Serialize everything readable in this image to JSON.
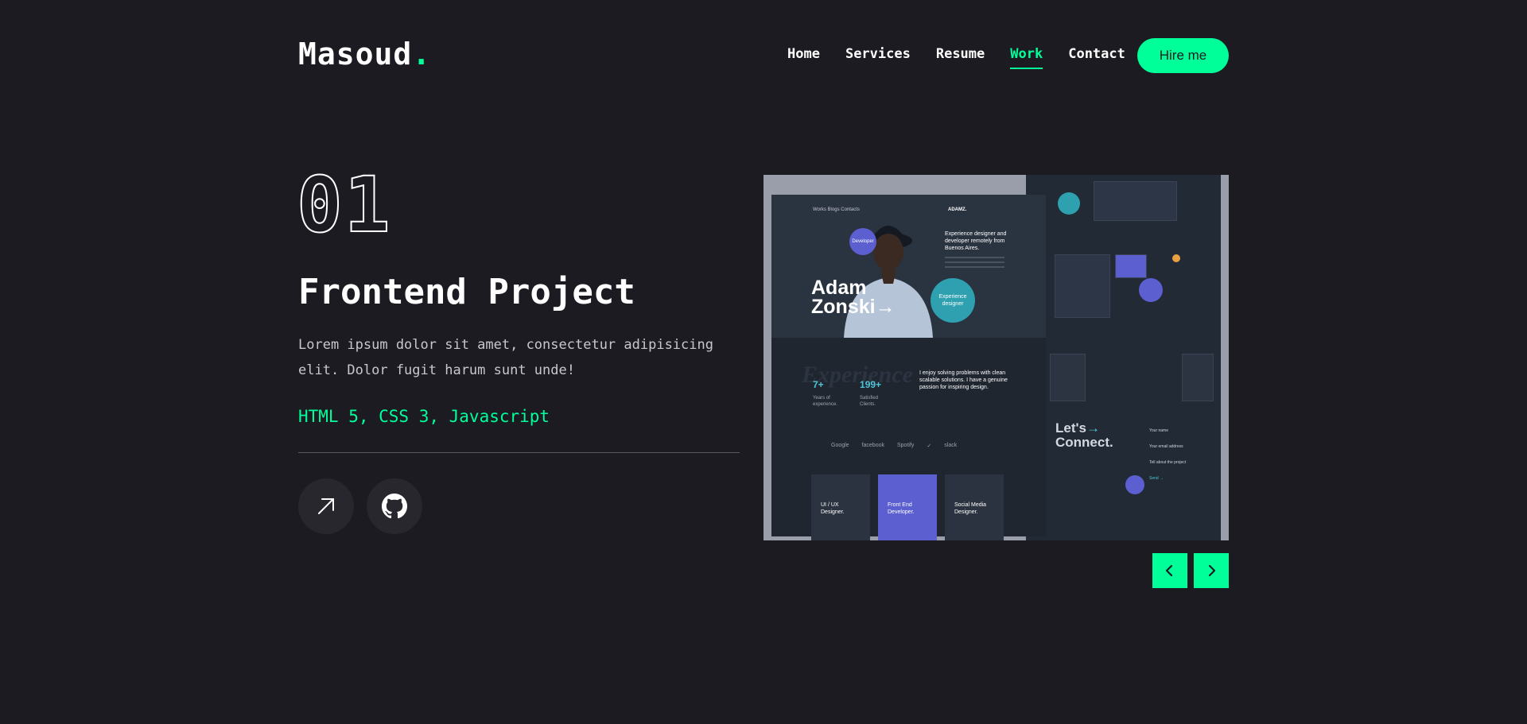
{
  "brand": {
    "name": "Masoud",
    "dot": "."
  },
  "nav": {
    "items": [
      {
        "label": "Home",
        "active": false
      },
      {
        "label": "Services",
        "active": false
      },
      {
        "label": "Resume",
        "active": false
      },
      {
        "label": "Work",
        "active": true
      },
      {
        "label": "Contact",
        "active": false
      }
    ],
    "hire_label": "Hire me"
  },
  "project": {
    "number": "01",
    "title": "Frontend Project",
    "description": "Lorem ipsum dolor sit amet, consectetur adipisicing elit. Dolor fugit harum sunt unde!",
    "stack": "HTML 5, CSS 3, Javascript"
  },
  "actions": {
    "live_icon": "arrow-up-right-icon",
    "github_icon": "github-icon"
  },
  "preview": {
    "nav": "Works   Blogs   Contacts",
    "brand": "ADAMZ.",
    "name_line1": "Adam",
    "name_line2": "Zonski",
    "developer_badge": "Developer",
    "experience_badge_1": "Experience",
    "experience_badge_2": "designer",
    "blurb": "Experience designer and developer remotely from Buenos Aires.",
    "experience_word": "Experience",
    "stats": [
      {
        "value": "7+",
        "label1": "Years of",
        "label2": "experience."
      },
      {
        "value": "199+",
        "label1": "Satisfied",
        "label2": "Clients."
      }
    ],
    "about": "I enjoy solving problems with clean scalable solutions. I have a genuine passion for inspiring design.",
    "logos": [
      "Google",
      "facebook",
      "Spotify",
      "✓",
      "slack"
    ],
    "cards": [
      {
        "line1": "UI / UX",
        "line2": "Designer.",
        "highlight": false
      },
      {
        "line1": "Front End",
        "line2": "Developer.",
        "highlight": true
      },
      {
        "line1": "Social Media",
        "line2": "Designer.",
        "highlight": false
      }
    ],
    "connect_line1": "Let's",
    "connect_line2": "Connect.",
    "form": [
      "Your name",
      "Your email address",
      "Tell about the project",
      "Send →"
    ]
  },
  "slider": {
    "prev_icon": "chevron-left-icon",
    "next_icon": "chevron-right-icon"
  },
  "colors": {
    "accent": "#00ff99",
    "background": "#1c1b22",
    "muted_text": "#c8c8cc"
  }
}
